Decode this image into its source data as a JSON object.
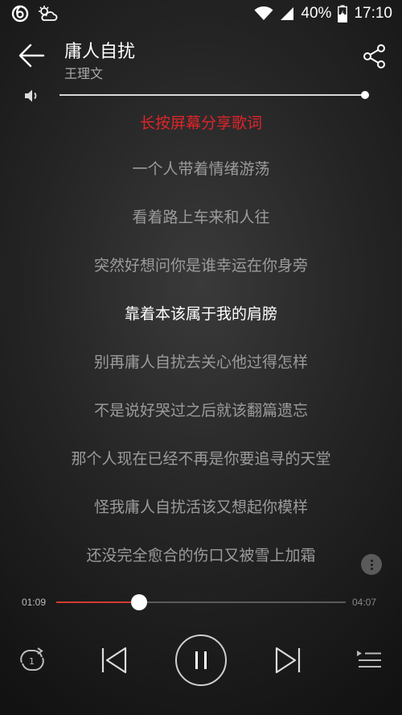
{
  "status_bar": {
    "battery": "40%",
    "time": "17:10",
    "icons": [
      "netease-music-icon",
      "weather-icon",
      "wifi-icon",
      "cell-signal-icon",
      "battery-charging-icon"
    ]
  },
  "header": {
    "title": "庸人自扰",
    "artist": "王理文"
  },
  "volume": {
    "level": 1.0
  },
  "lyrics": {
    "share_hint": "长按屏幕分享歌词",
    "lines": [
      "一个人带着情绪游荡",
      "看着路上车来和人往",
      "突然好想问你是谁幸运在你身旁",
      "靠着本该属于我的肩膀",
      "别再庸人自扰去关心他过得怎样",
      "不是说好哭过之后就该翻篇遗忘",
      "那个人现在已经不再是你要追寻的天堂",
      "怪我庸人自扰活该又想起你模样",
      "还没完全愈合的伤口又被雪上加霜"
    ],
    "active_index": 3
  },
  "player": {
    "current_time": "01:09",
    "total_time": "04:07",
    "progress": 0.287
  },
  "colors": {
    "accent": "#d33a31",
    "hint": "#e0242a",
    "lyric_inactive": "#9b9b9b",
    "lyric_active": "#ffffff"
  }
}
